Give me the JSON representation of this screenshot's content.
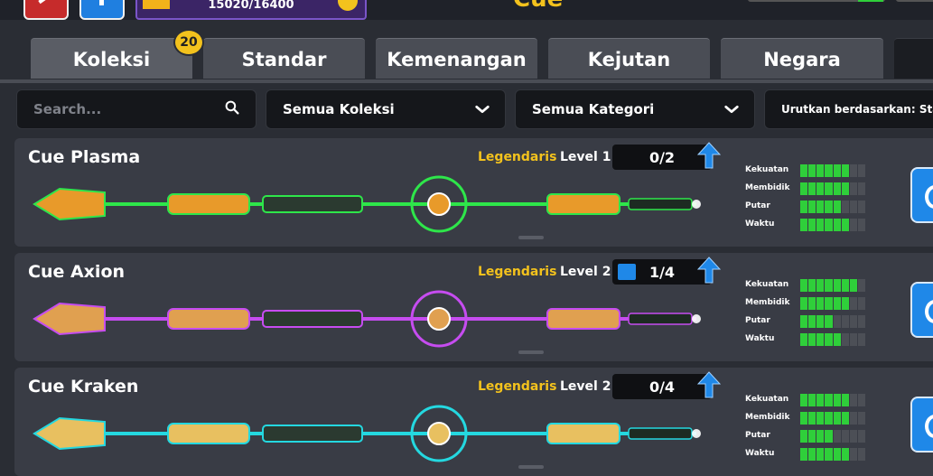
{
  "topbar": {
    "xp_text": "15020/16400",
    "xp_fraction": 0.916,
    "title_partial": "Cue"
  },
  "tabs": [
    {
      "label": "Koleksi",
      "badge": "20"
    },
    {
      "label": "Standar"
    },
    {
      "label": "Kemenangan"
    },
    {
      "label": "Kejutan"
    },
    {
      "label": "Negara"
    }
  ],
  "filters": {
    "search_placeholder": "Search...",
    "collection": "Semua Koleksi",
    "category": "Semua Kategori",
    "sort": "Urutkan berdasarkan: Sta"
  },
  "stat_labels": [
    "Kekuatan",
    "Membidik",
    "Putar",
    "Waktu"
  ],
  "cues": [
    {
      "name": "Cue Plasma",
      "rarity": "Legendaris",
      "level": "Level 1",
      "progress": "0/2",
      "stats": [
        6,
        6,
        5,
        6
      ],
      "stat_max": 8,
      "colors": {
        "glow": "#2ee64a",
        "body": "#e89a2a"
      }
    },
    {
      "name": "Cue Axion",
      "rarity": "Legendaris",
      "level": "Level 2",
      "progress": "1/4",
      "stats": [
        7,
        6,
        4,
        5
      ],
      "stat_max": 8,
      "colors": {
        "glow": "#c64cf0",
        "body": "#e0a050"
      }
    },
    {
      "name": "Cue Kraken",
      "rarity": "Legendaris",
      "level": "Level 2",
      "progress": "0/4",
      "stats": [
        6,
        6,
        4,
        6
      ],
      "stat_max": 8,
      "colors": {
        "glow": "#24d8e0",
        "body": "#e8c060"
      }
    }
  ],
  "colors": {
    "accent_yellow": "#f3c21d",
    "stat_green": "#2fcf3a",
    "button_blue": "#1f88e8"
  }
}
